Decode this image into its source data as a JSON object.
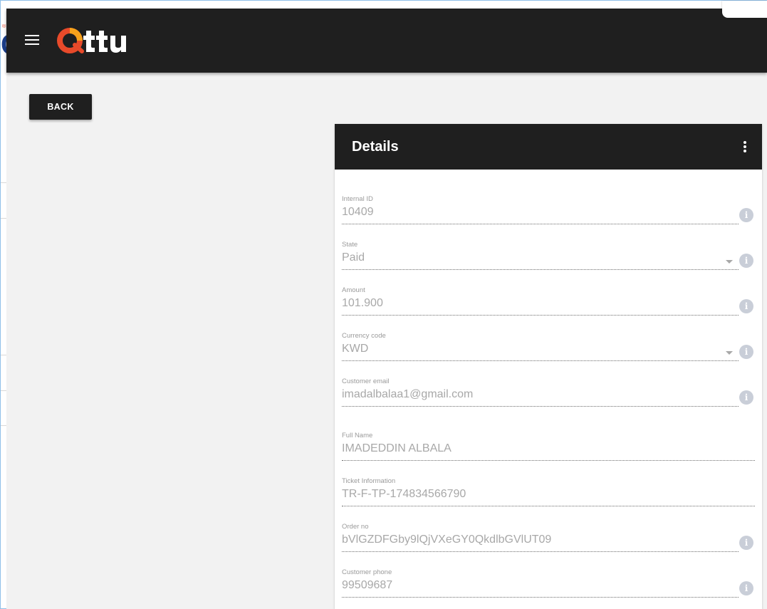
{
  "header": {
    "brand": "Ottu",
    "brand_colors": {
      "ring": "#e84a2a",
      "accent": "#f7a21b",
      "text": "#ffffff"
    },
    "menu_icon": "hamburger-menu-icon"
  },
  "actions": {
    "back_label": "BACK"
  },
  "details": {
    "title": "Details",
    "menu_icon": "more-vert-icon",
    "fields": [
      {
        "label": "Internal ID",
        "value": "10409",
        "info": "i"
      },
      {
        "label": "State",
        "value": "Paid",
        "dropdown": true,
        "info": "i"
      },
      {
        "label": "Amount",
        "value": "101.900",
        "info": "i"
      },
      {
        "label": "Currency code",
        "value": "KWD",
        "dropdown": true,
        "info": "i"
      },
      {
        "label": "Customer email",
        "value": "imadalbalaa1@gmail.com",
        "info": "i"
      },
      {
        "label": "Full Name",
        "value": "IMADEDDIN ALBALA"
      },
      {
        "label": "Ticket Information",
        "value": "TR-F-TP-174834566790"
      },
      {
        "label": "Order no",
        "value": "bVlGZDFGby9lQjVXeGY0QkdlbGVlUT09",
        "info": "i"
      },
      {
        "label": "Customer phone",
        "value": "99509687",
        "info": "i"
      }
    ]
  }
}
